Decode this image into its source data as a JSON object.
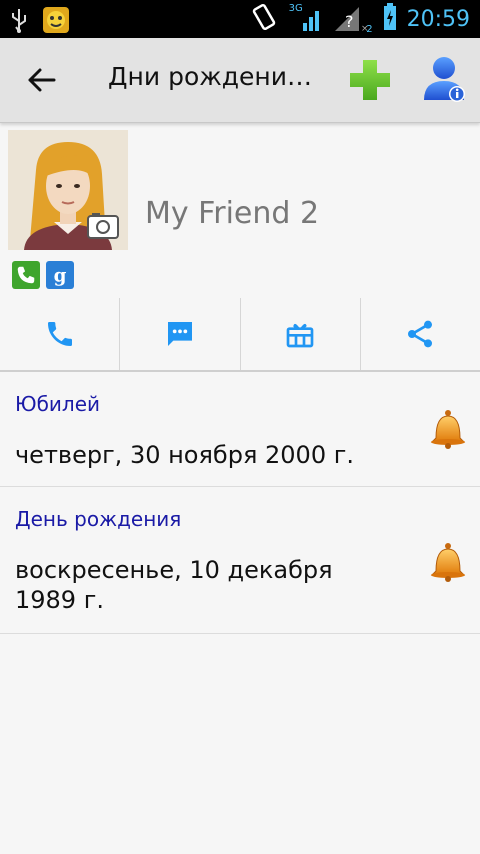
{
  "status_bar": {
    "time": "20:59",
    "network": "3G",
    "sim2_label": "2"
  },
  "toolbar": {
    "title": "Дни рождени…",
    "back_icon": "arrow-back-icon",
    "add_icon": "green-plus-icon",
    "profile_icon": "user-info-icon"
  },
  "contact": {
    "name": "My Friend 2",
    "sources": [
      "phone-icon",
      "google-icon"
    ]
  },
  "actions": [
    {
      "icon": "phone-icon"
    },
    {
      "icon": "message-icon"
    },
    {
      "icon": "gift-icon"
    },
    {
      "icon": "share-icon"
    }
  ],
  "events": [
    {
      "label": "Юбилей",
      "date": "четверг, 30 ноября 2000 г."
    },
    {
      "label": "День рождения",
      "date": "воскресенье, 10 декабря 1989 г."
    }
  ],
  "colors": {
    "accent_blue": "#2196f3",
    "label_blue": "#1a1aa6",
    "toolbar_bg": "#e3e3e3"
  }
}
